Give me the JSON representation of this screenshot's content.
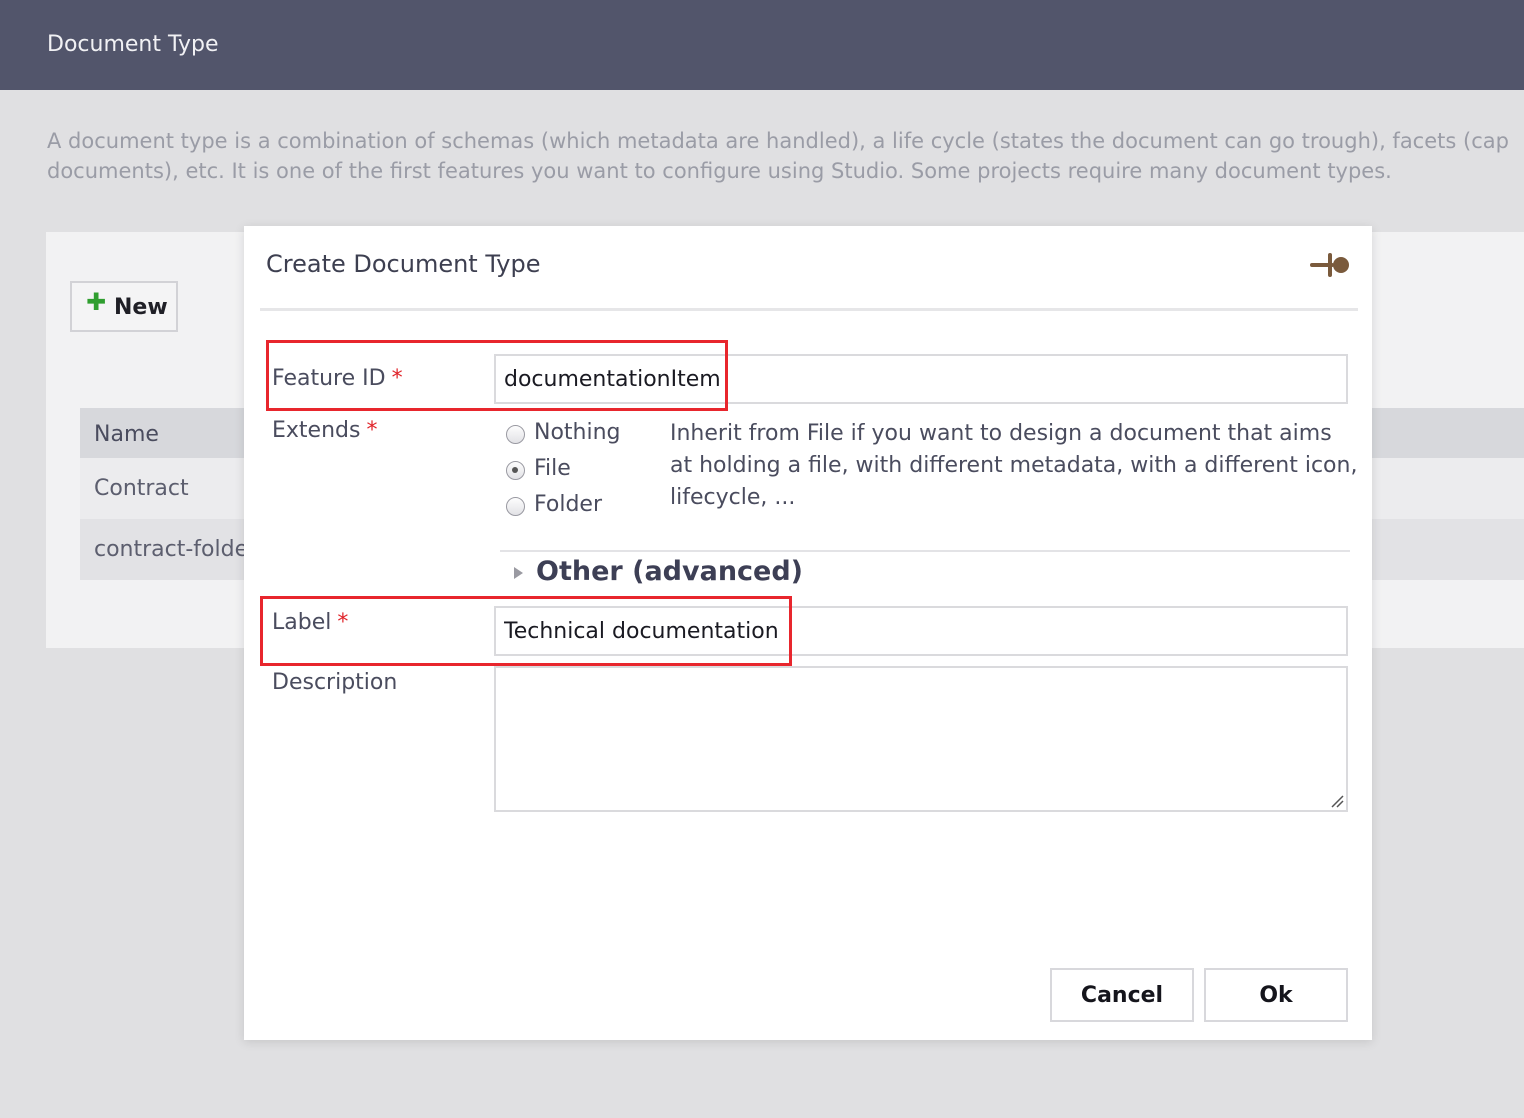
{
  "header": {
    "title": "Document Type"
  },
  "intro": {
    "line1": "A document type is a combination of schemas (which metadata are handled), a life cycle (states the document can go trough), facets (cap",
    "line2": "documents), etc. It is one of the first features you want to configure using Studio. Some projects require many document types."
  },
  "toolbar": {
    "new_label": "New",
    "new_icon": "plus-icon"
  },
  "table": {
    "header": "Name",
    "rows": [
      "Contract",
      "contract-folde"
    ]
  },
  "dialog": {
    "title": "Create Document Type",
    "pin_icon": "pin-icon",
    "feature_id": {
      "label": "Feature ID",
      "value": "documentationItem"
    },
    "extends": {
      "label": "Extends",
      "options": [
        "Nothing",
        "File",
        "Folder"
      ],
      "selected": "File",
      "help": "Inherit from File if you want to design a document that aims at holding a file, with different metadata, with a different icon, lifecycle, ..."
    },
    "advanced_label": "Other (advanced)",
    "label_field": {
      "label": "Label",
      "value": "Technical documentation"
    },
    "description": {
      "label": "Description",
      "value": ""
    },
    "required_mark": "*",
    "cancel_label": "Cancel",
    "ok_label": "Ok"
  },
  "colors": {
    "header_bg": "#52556b",
    "required": "#e0242a",
    "highlight": "#e8262d",
    "plus": "#2f9e2f"
  }
}
